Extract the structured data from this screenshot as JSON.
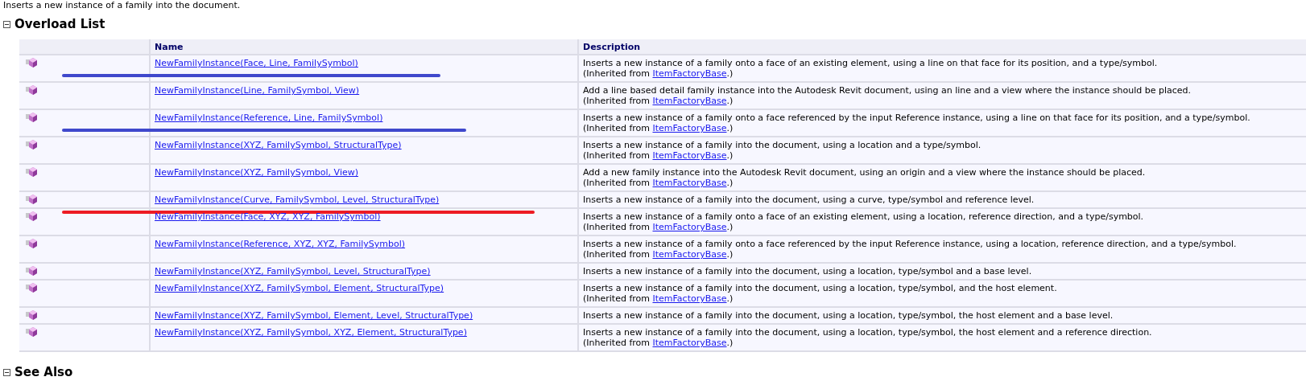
{
  "summary": "Inserts a new instance of a family into the document.",
  "overload_section": {
    "title": "Overload List",
    "expanded": true,
    "table": {
      "columns": [
        "Name",
        "Description"
      ],
      "rows": [
        {
          "name": "NewFamilyInstance(Face, Line, FamilySymbol)",
          "description": "Inserts a new instance of a family onto a face of an existing element, using a line on that face for its position, and a type/symbol.",
          "inherited": {
            "prefix": "(Inherited from ",
            "link": "ItemFactoryBase",
            "suffix": ".)"
          },
          "color": "#3f48cc"
        },
        {
          "name": "NewFamilyInstance(Line, FamilySymbol, View)",
          "description": "Add a line based detail family instance into the Autodesk Revit document, using an line and a view where the instance should be placed.",
          "inherited": {
            "prefix": "(Inherited from ",
            "link": "ItemFactoryBase",
            "suffix": ".)"
          }
        },
        {
          "name": "NewFamilyInstance(Reference, Line, FamilySymbol)",
          "description": "Inserts a new instance of a family onto a face referenced by the input Reference instance, using a line on that face for its position, and a type/symbol.",
          "inherited": {
            "prefix": "(Inherited from ",
            "link": "ItemFactoryBase",
            "suffix": ".)"
          },
          "color": "#3f48cc"
        },
        {
          "name": "NewFamilyInstance(XYZ, FamilySymbol, StructuralType)",
          "description": "Inserts a new instance of a family into the document, using a location and a type/symbol.",
          "inherited": {
            "prefix": "(Inherited from ",
            "link": "ItemFactoryBase",
            "suffix": ".)"
          }
        },
        {
          "name": "NewFamilyInstance(XYZ, FamilySymbol, View)",
          "description": "Add a new family instance into the Autodesk Revit document, using an origin and a view where the instance should be placed.",
          "inherited": {
            "prefix": "(Inherited from ",
            "link": "ItemFactoryBase",
            "suffix": ".)"
          }
        },
        {
          "name": "NewFamilyInstance(Curve, FamilySymbol, Level, StructuralType)",
          "description": "Inserts a new instance of a family into the document, using a curve, type/symbol and reference level.",
          "color": "#ed1c24"
        },
        {
          "name": "NewFamilyInstance(Face, XYZ, XYZ, FamilySymbol)",
          "description": "Inserts a new instance of a family onto a face of an existing element, using a location, reference direction, and a type/symbol.",
          "inherited": {
            "prefix": "(Inherited from ",
            "link": "ItemFactoryBase",
            "suffix": ".)"
          }
        },
        {
          "name": "NewFamilyInstance(Reference, XYZ, XYZ, FamilySymbol)",
          "description": "Inserts a new instance of a family onto a face referenced by the input Reference instance, using a location, reference direction, and a type/symbol.",
          "inherited": {
            "prefix": "(Inherited from ",
            "link": "ItemFactoryBase",
            "suffix": ".)"
          }
        },
        {
          "name": "NewFamilyInstance(XYZ, FamilySymbol, Level, StructuralType)",
          "description": "Inserts a new instance of a family into the document, using a location, type/symbol and a base level."
        },
        {
          "name": "NewFamilyInstance(XYZ, FamilySymbol, Element, StructuralType)",
          "description": "Inserts a new instance of a family into the document, using a location, type/symbol, and the host element.",
          "inherited": {
            "prefix": "(Inherited from ",
            "link": "ItemFactoryBase",
            "suffix": ".)"
          }
        },
        {
          "name": "NewFamilyInstance(XYZ, FamilySymbol, Element, Level, StructuralType)",
          "description": "Inserts a new instance of a family into the document, using a location, type/symbol, the host element and a base level."
        },
        {
          "name": "NewFamilyInstance(XYZ, FamilySymbol, XYZ, Element, StructuralType)",
          "description": "Inserts a new instance of a family into the document, using a location, type/symbol, the host element and a reference direction.",
          "inherited": {
            "prefix": "(Inherited from ",
            "link": "ItemFactoryBase",
            "suffix": ".)"
          }
        }
      ]
    }
  },
  "see_also_section": {
    "title": "See Also",
    "expanded": true
  }
}
